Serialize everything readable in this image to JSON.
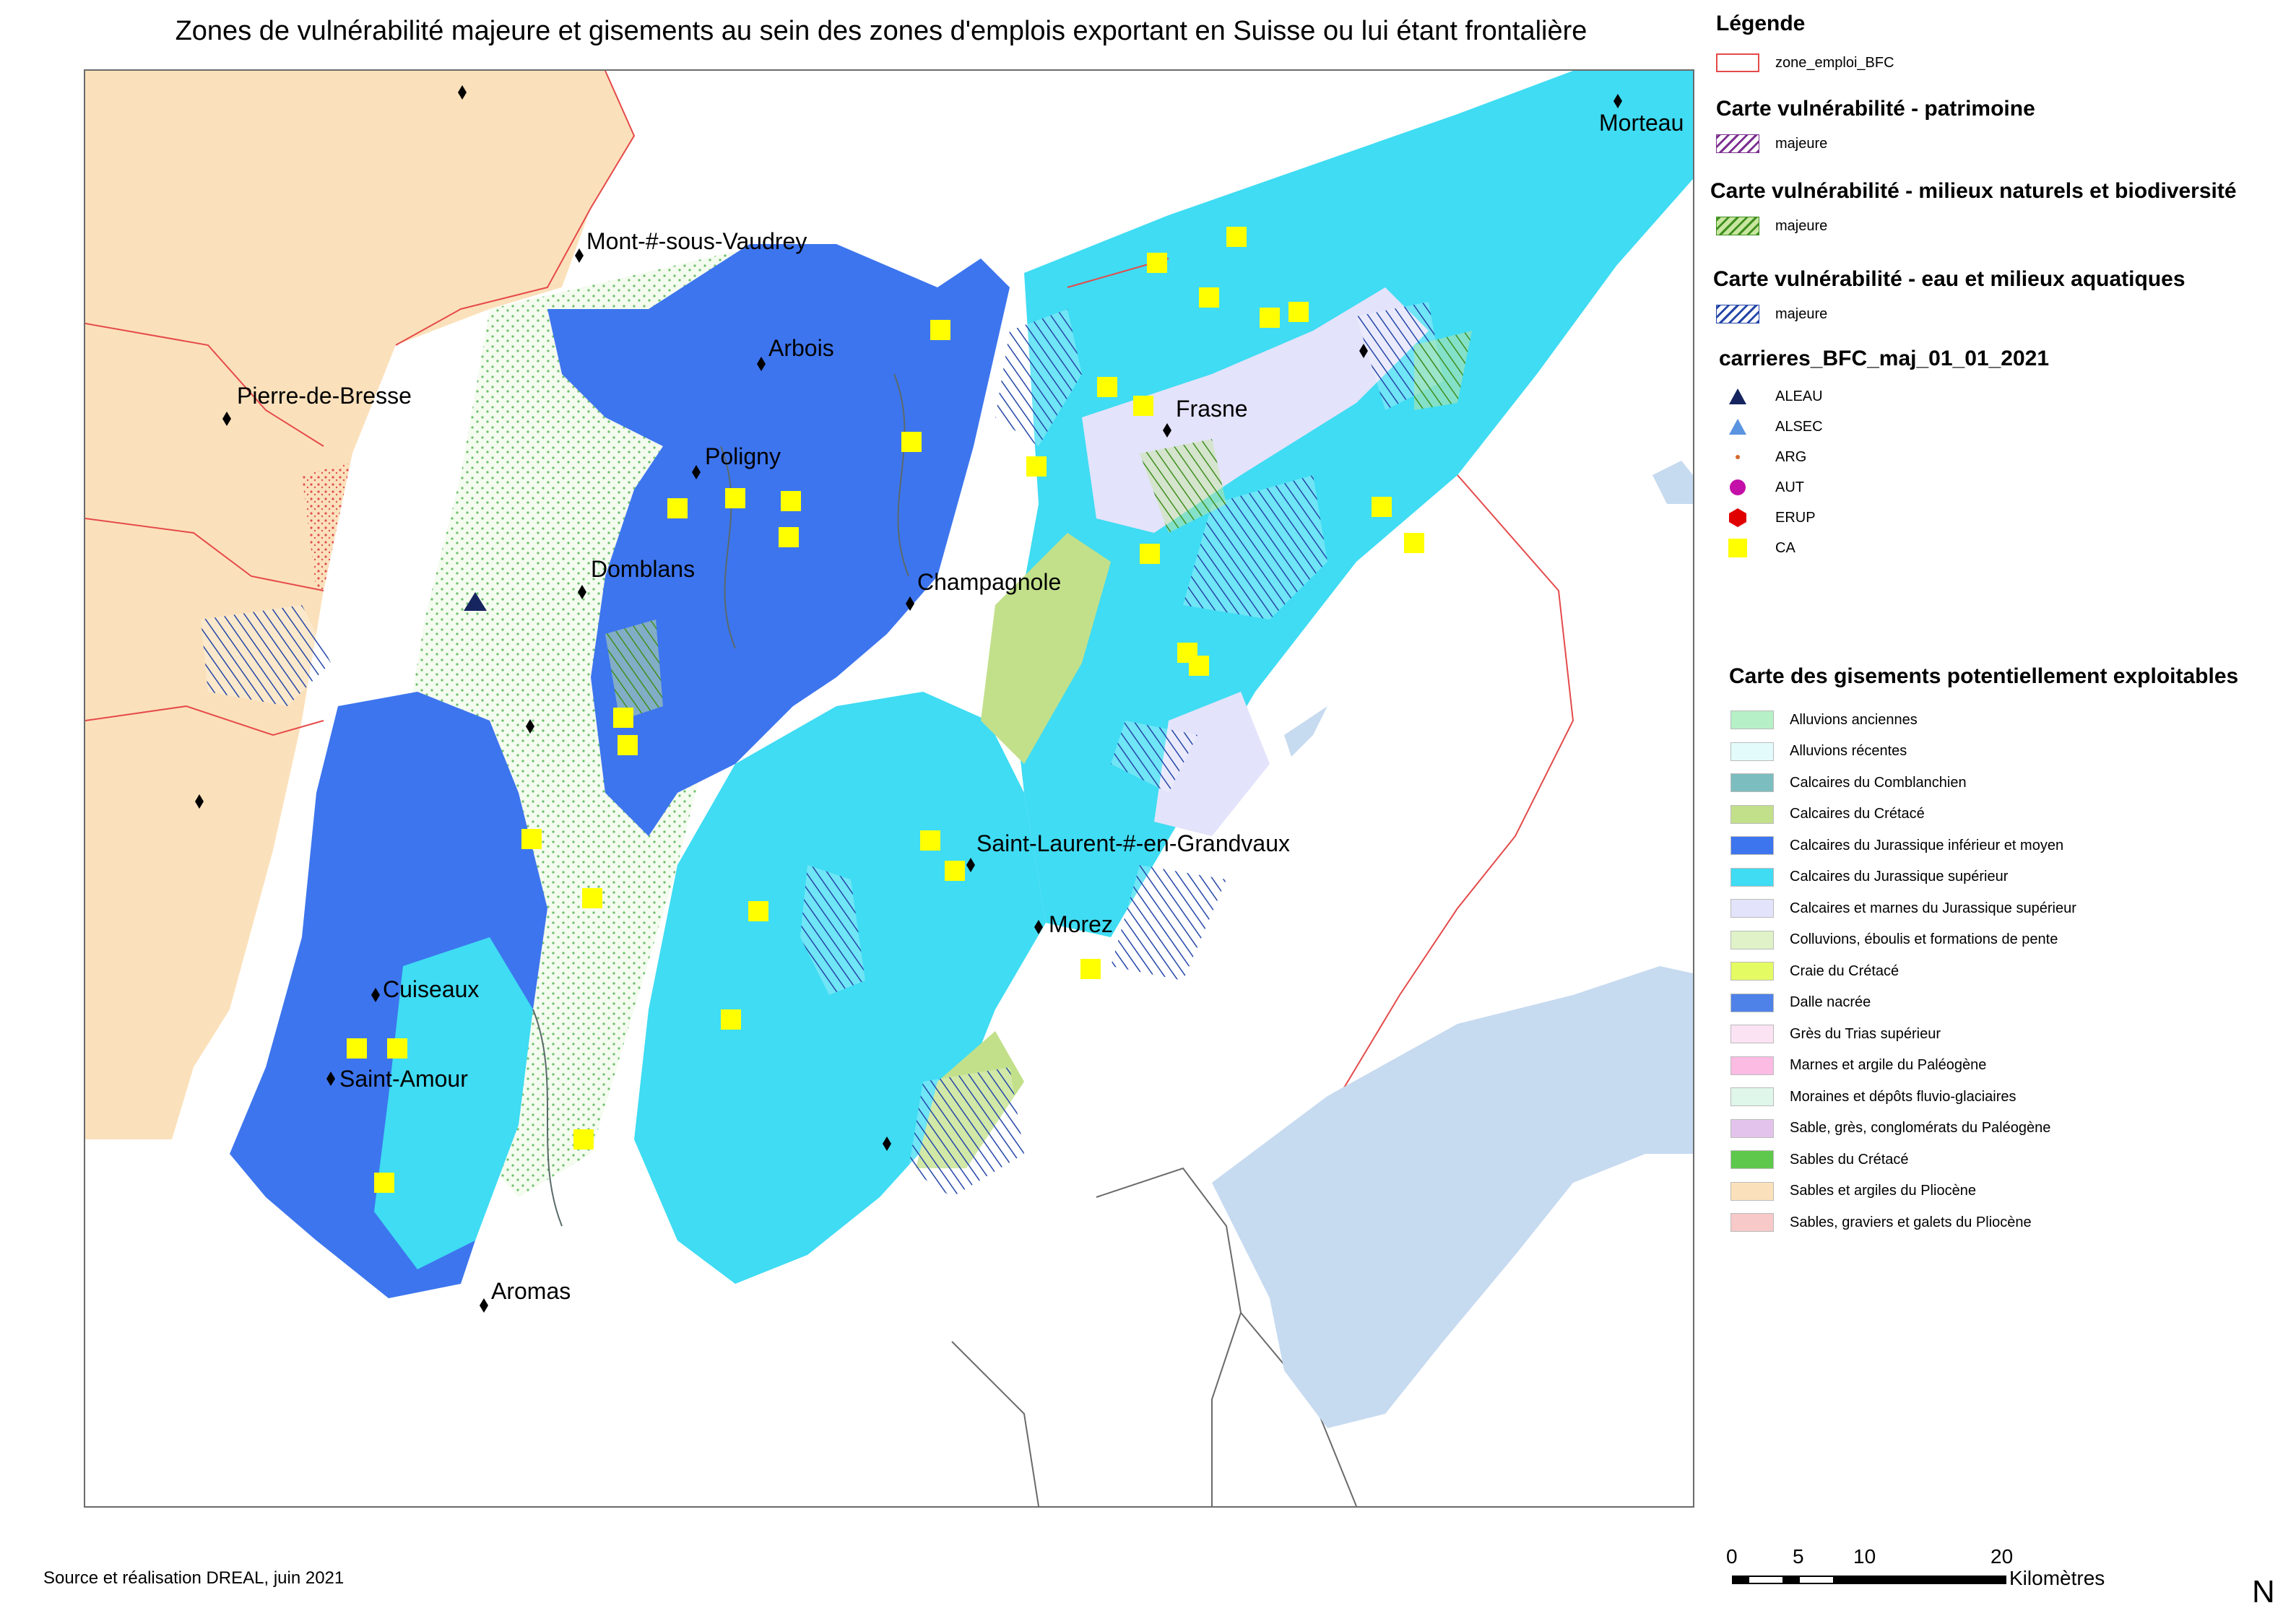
{
  "title": "Zones de vulnérabilité majeure et gisements au sein des zones d'emplois exportant en Suisse ou lui étant frontalière",
  "source": "Source et réalisation DREAL, juin 2021",
  "cities": [
    {
      "name": "Mont-#-sous-Vaudrey"
    },
    {
      "name": "Pierre-de-Bresse"
    },
    {
      "name": "Arbois"
    },
    {
      "name": "Poligny"
    },
    {
      "name": "Domblans"
    },
    {
      "name": "Champagnole"
    },
    {
      "name": "Frasne"
    },
    {
      "name": "Morteau"
    },
    {
      "name": "Saint-Laurent-#-en-Grandvaux"
    },
    {
      "name": "Morez"
    },
    {
      "name": "Cuiseaux"
    },
    {
      "name": "Saint-Amour"
    },
    {
      "name": "Aromas"
    }
  ],
  "legend": {
    "heading": "Légende",
    "zone_label": "zone_emploi_BFC",
    "vuln_patrimoine": {
      "title": "Carte vulnérabilité - patrimoine",
      "item": "majeure",
      "color": "#7b2f8f"
    },
    "vuln_milieux": {
      "title": "Carte vulnérabilité - milieux naturels et biodiversité",
      "item": "majeure",
      "color": "#3f8f1f"
    },
    "vuln_eau": {
      "title": "Carte vulnérabilité - eau et milieux aquatiques",
      "item": "majeure",
      "color": "#2446a8"
    },
    "carrieres": {
      "title": "carrieres_BFC_maj_01_01_2021",
      "items": [
        {
          "label": "ALEAU",
          "icon": "triangle-icon",
          "color": "#16245f"
        },
        {
          "label": "ALSEC",
          "icon": "triangle-icon",
          "color": "#5a93e0"
        },
        {
          "label": "ARG",
          "icon": "small-dot-icon",
          "color": "#d6682a"
        },
        {
          "label": "AUT",
          "icon": "circle-icon",
          "color": "#c40fa8"
        },
        {
          "label": "ERUP",
          "icon": "hexagon-icon",
          "color": "#e00000"
        },
        {
          "label": "CA",
          "icon": "square-icon",
          "color": "#ffff00"
        }
      ]
    },
    "gisements": {
      "title": "Carte des gisements potentiellement exploitables",
      "items": [
        {
          "label": "Alluvions anciennes",
          "color": "#b6f0c6"
        },
        {
          "label": "Alluvions récentes",
          "color": "#e3fbfb"
        },
        {
          "label": "Calcaires du Comblanchien",
          "color": "#7cbdbf"
        },
        {
          "label": "Calcaires du Crétacé",
          "color": "#c2e08a"
        },
        {
          "label": "Calcaires du Jurassique inférieur et moyen",
          "color": "#3d75ee"
        },
        {
          "label": "Calcaires du Jurassique supérieur",
          "color": "#3fdcf3"
        },
        {
          "label": "Calcaires et marnes du Jurassique supérieur",
          "color": "#e3e3fb"
        },
        {
          "label": "Colluvions, éboulis et formations de pente",
          "color": "#dff2c8"
        },
        {
          "label": "Craie du Crétacé",
          "color": "#e5fb64"
        },
        {
          "label": "Dalle nacrée",
          "color": "#4f82e8"
        },
        {
          "label": "Grès du Trias supérieur",
          "color": "#fbe3f4"
        },
        {
          "label": "Marnes et argile du Paléogène",
          "color": "#fbbbe3"
        },
        {
          "label": "Moraines et dépôts fluvio-glaciaires",
          "color": "#dff6ea"
        },
        {
          "label": "Sable, grès, conglomérats du Paléogène",
          "color": "#e3c3eb"
        },
        {
          "label": "Sables du Crétacé",
          "color": "#5ec84c"
        },
        {
          "label": "Sables et argiles du Pliocène",
          "color": "#fbe1bb"
        },
        {
          "label": "Sables, graviers et galets du Pliocène",
          "color": "#f7c9c9"
        }
      ]
    }
  },
  "scale": {
    "ticks": [
      "0",
      "5",
      "10",
      "20"
    ],
    "unit": "Kilomètres"
  },
  "north": "N"
}
